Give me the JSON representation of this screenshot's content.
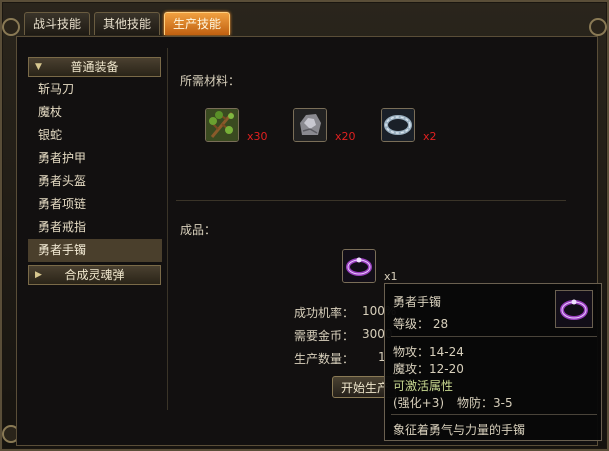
{
  "tabs": [
    {
      "label": "战斗技能"
    },
    {
      "label": "其他技能"
    },
    {
      "label": "生产技能"
    }
  ],
  "categories": {
    "normal": {
      "label": "普通装备"
    },
    "soul": {
      "label": "合成灵魂弹"
    }
  },
  "recipes": [
    {
      "label": "斩马刀"
    },
    {
      "label": "魔杖"
    },
    {
      "label": "银蛇"
    },
    {
      "label": "勇者护甲"
    },
    {
      "label": "勇者头盔"
    },
    {
      "label": "勇者项链"
    },
    {
      "label": "勇者戒指"
    },
    {
      "label": "勇者手镯"
    }
  ],
  "materials_label": "所需材料：",
  "materials": [
    {
      "icon": "wood-branch-icon",
      "qty": "x30"
    },
    {
      "icon": "iron-ore-icon",
      "qty": "x20"
    },
    {
      "icon": "chain-icon",
      "qty": "x2"
    }
  ],
  "product_label": "成品：",
  "product": {
    "icon": "bracelet-icon",
    "qty": "x1"
  },
  "info": {
    "success_label": "成功机率：",
    "success_value": "100%",
    "gold_label": "需要金币：",
    "gold_value": "3000",
    "qty_label": "生产数量：",
    "qty_value": "1"
  },
  "start_button": "开始生产",
  "tooltip": {
    "name": "勇者手镯",
    "level": "等级： 28",
    "attack": "物攻：14-24",
    "magic": "魔攻：12-20",
    "activatable": "可激活属性",
    "enhance": "(强化+3)",
    "defense": "物防：3-5",
    "description": "象征着勇气与力量的手镯"
  },
  "colors": {
    "active_tab": "#e08020",
    "qty_red": "#e02020",
    "tooltip_green": "#c8d890"
  }
}
